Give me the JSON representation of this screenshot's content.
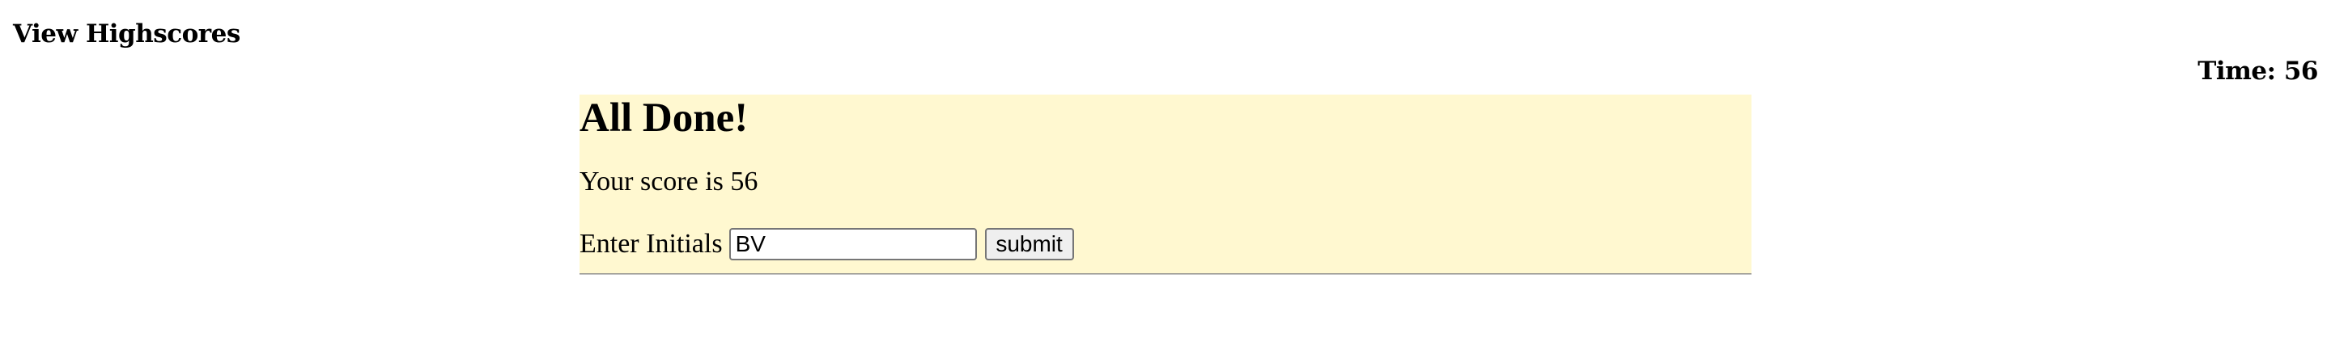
{
  "header": {
    "highscores_link": "View Highscores",
    "timer_label": "Time: 56"
  },
  "result": {
    "heading": "All Done!",
    "score_text": "Your score is 56",
    "initials_label": "Enter Initials",
    "initials_value": "BV",
    "submit_label": "submit"
  },
  "colors": {
    "panel_background": "#fff8d0",
    "page_background": "#ffffff"
  }
}
